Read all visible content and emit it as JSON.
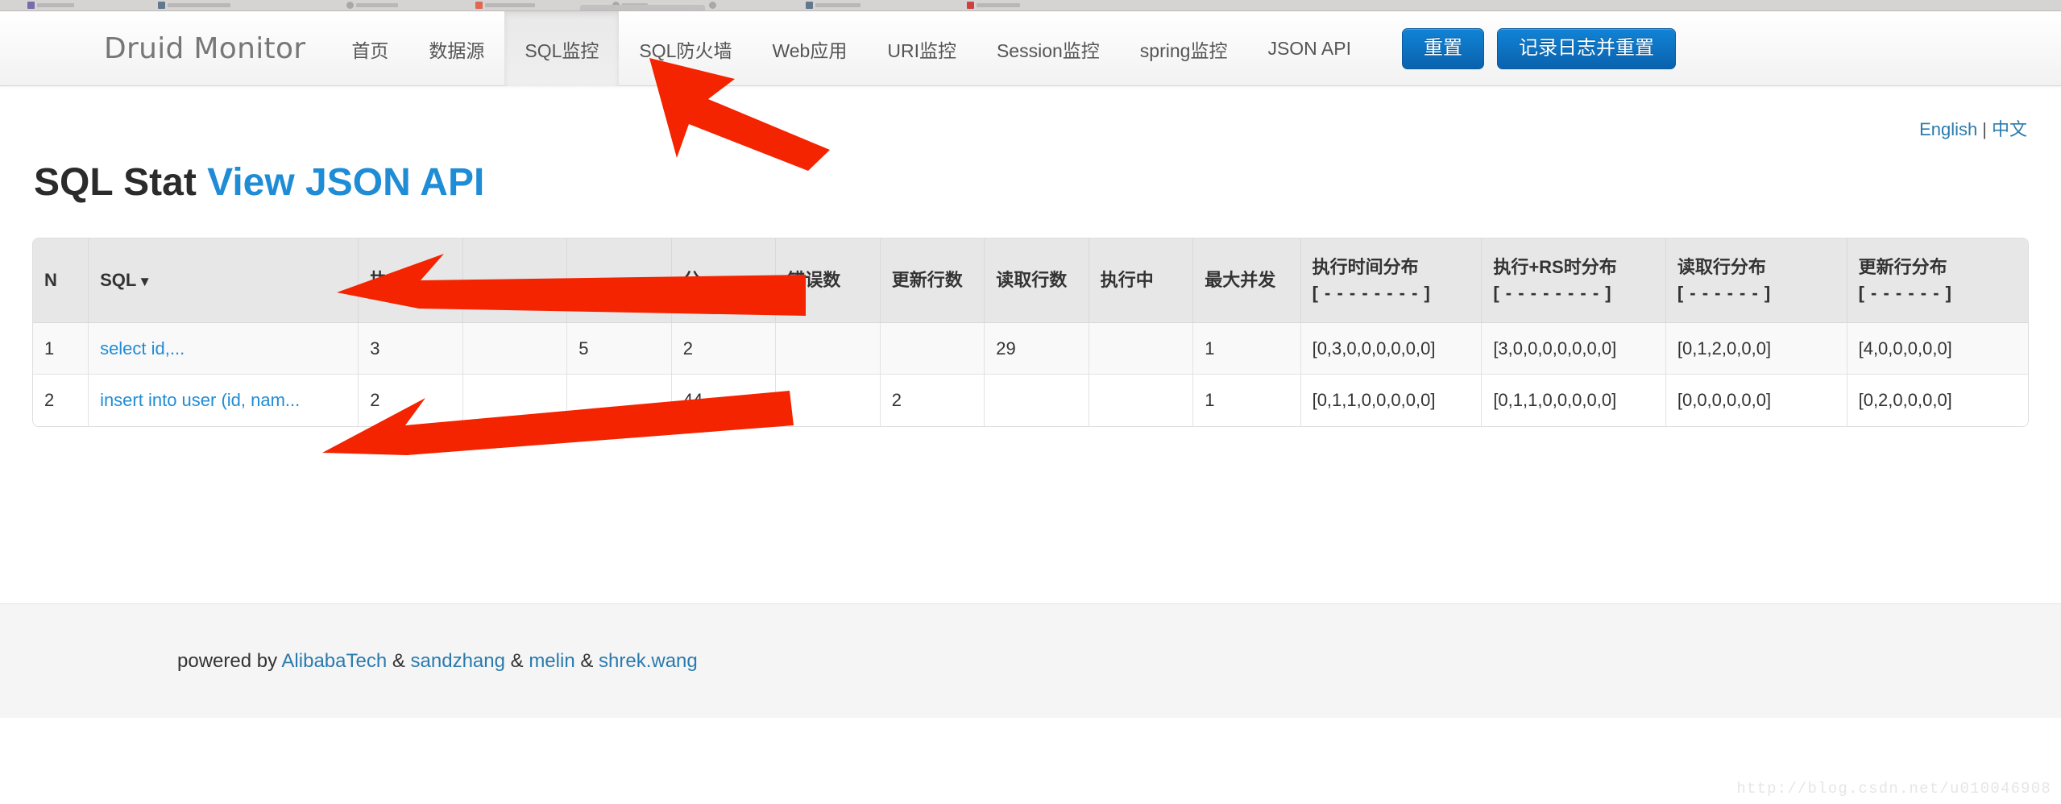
{
  "browser": {
    "bookmarks": [
      "",
      "",
      "",
      "",
      "",
      "",
      "",
      ""
    ]
  },
  "navbar": {
    "brand": "Druid Monitor",
    "items": [
      {
        "label": "首页",
        "active": false
      },
      {
        "label": "数据源",
        "active": false
      },
      {
        "label": "SQL监控",
        "active": true
      },
      {
        "label": "SQL防火墙",
        "active": false
      },
      {
        "label": "Web应用",
        "active": false
      },
      {
        "label": "URI监控",
        "active": false
      },
      {
        "label": "Session监控",
        "active": false
      },
      {
        "label": "spring监控",
        "active": false
      },
      {
        "label": "JSON API",
        "active": false
      }
    ],
    "buttons": [
      {
        "label": "重置",
        "name": "reset-button"
      },
      {
        "label": "记录日志并重置",
        "name": "log-and-reset-button"
      }
    ],
    "accent_color": "#1183d6"
  },
  "lang": {
    "english": "English",
    "separator": "|",
    "chinese": "中文"
  },
  "page": {
    "title": "SQL Stat",
    "title_link": "View JSON API"
  },
  "table": {
    "columns": [
      {
        "label": "N",
        "sub": ""
      },
      {
        "label": "SQL",
        "sub": "",
        "sortable": true,
        "sort_caret": "▼"
      },
      {
        "label": "执",
        "sub": ""
      },
      {
        "label": "",
        "sub": ""
      },
      {
        "label": "",
        "sub": ""
      },
      {
        "label": "分",
        "sub": ""
      },
      {
        "label": "错误数",
        "sub": ""
      },
      {
        "label": "更新行数",
        "sub": ""
      },
      {
        "label": "读取行数",
        "sub": ""
      },
      {
        "label": "执行中",
        "sub": ""
      },
      {
        "label": "最大并发",
        "sub": ""
      },
      {
        "label": "执行时间分布",
        "sub": "[ - - - - - - - - ]"
      },
      {
        "label": "执行+RS时分布",
        "sub": "[ - - - - - - - - ]"
      },
      {
        "label": "读取行分布",
        "sub": "[ - - - - - - ]"
      },
      {
        "label": "更新行分布",
        "sub": "[ - - - - - - ]"
      }
    ],
    "rows": [
      {
        "n": "1",
        "sql": "select id,...",
        "c2": "3",
        "c3": "",
        "c4": "5",
        "c5": "2",
        "errors": "",
        "update_rows": "",
        "read_rows": "29",
        "running": "",
        "max_concurrent": "1",
        "exec_time_dist": "[0,3,0,0,0,0,0,0]",
        "exec_rs_time_dist": "[3,0,0,0,0,0,0,0]",
        "read_rows_dist": "[0,1,2,0,0,0]",
        "update_rows_dist": "[4,0,0,0,0,0]"
      },
      {
        "n": "2",
        "sql": "insert into user (id, nam...",
        "c2": "2",
        "c3": "",
        "c4": "",
        "c5": "44",
        "errors": "",
        "update_rows": "2",
        "read_rows": "",
        "running": "",
        "max_concurrent": "1",
        "exec_time_dist": "[0,1,1,0,0,0,0,0]",
        "exec_rs_time_dist": "[0,1,1,0,0,0,0,0]",
        "read_rows_dist": "[0,0,0,0,0,0]",
        "update_rows_dist": "[0,2,0,0,0,0]"
      }
    ]
  },
  "footer": {
    "prefix": "powered by ",
    "links": [
      "AlibabaTech",
      "sandzhang",
      "melin",
      "shrek.wang"
    ],
    "separator": " & "
  },
  "watermark": "http://blog.csdn.net/u010046908",
  "annotations": {
    "arrow_color": "#f42300",
    "arrows": [
      {
        "name": "arrow-to-sql-monitor-tab"
      },
      {
        "name": "arrow-to-exec-count-header"
      },
      {
        "name": "arrow-to-exec-count-row2"
      }
    ]
  }
}
